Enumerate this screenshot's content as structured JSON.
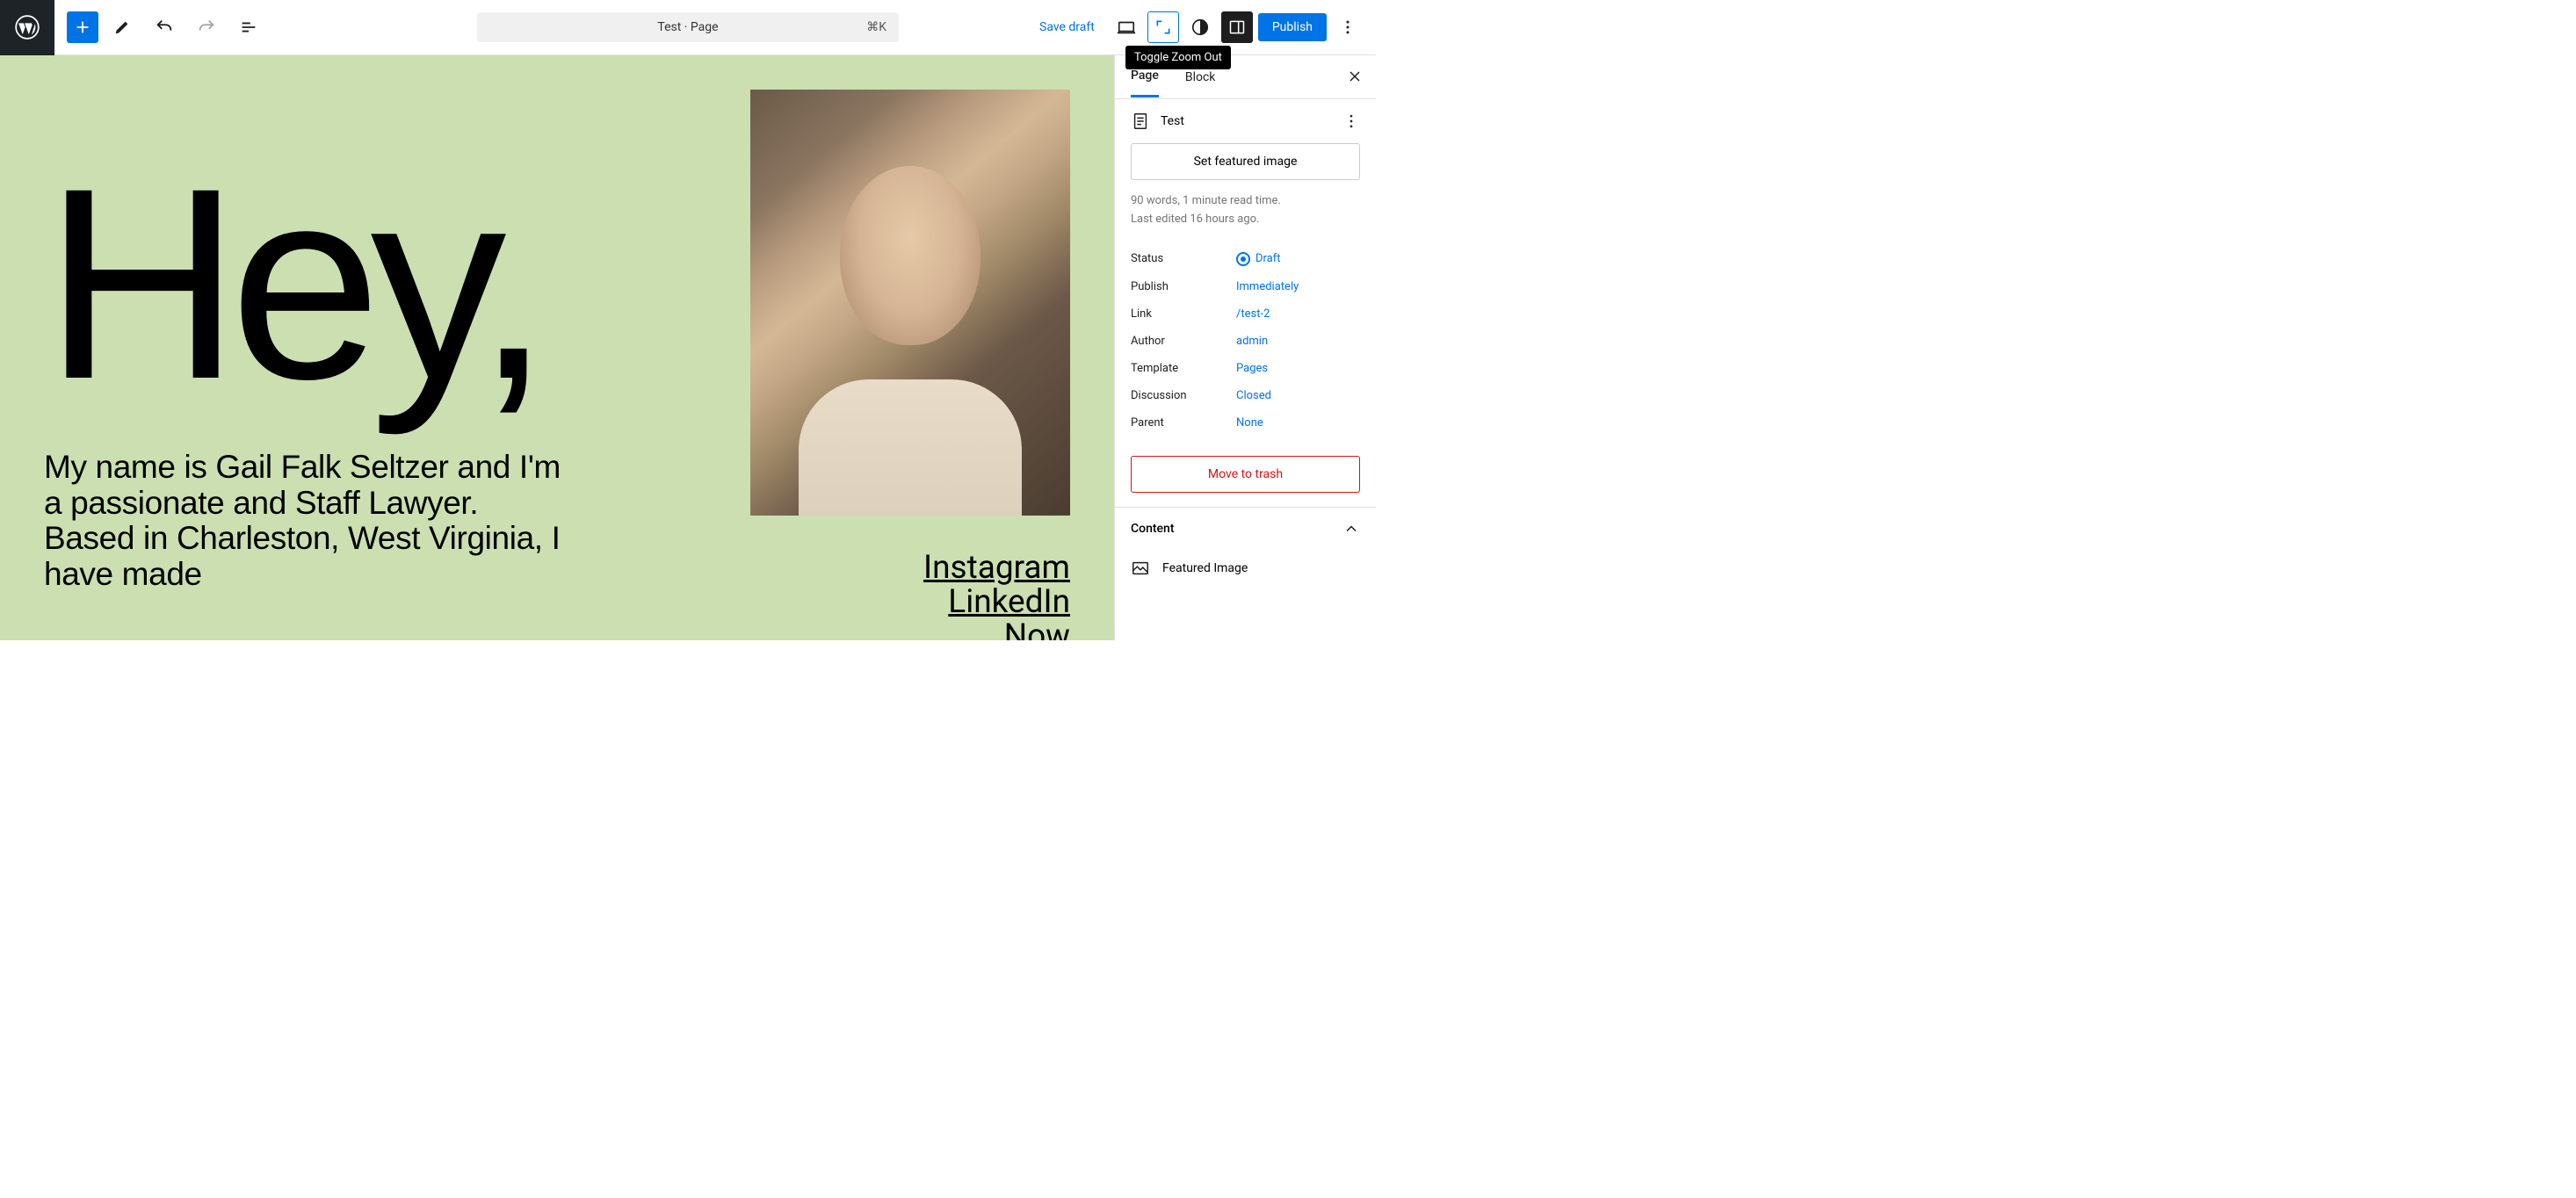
{
  "topbar": {
    "doc_title": "Test · Page",
    "kbd": "⌘K",
    "save_draft": "Save draft",
    "publish": "Publish",
    "tooltip": "Toggle Zoom Out"
  },
  "canvas": {
    "heading": "Hey,",
    "intro": "My name is Gail Falk Seltzer and I'm a passionate and Staff Lawyer. Based in Charleston, West Virginia, I have made",
    "links": [
      "Instagram",
      "LinkedIn",
      "Now"
    ]
  },
  "sidebar": {
    "tabs": {
      "page": "Page",
      "block": "Block"
    },
    "page_title": "Test",
    "featured_btn": "Set featured image",
    "meta1": "90 words, 1 minute read time.",
    "meta2": "Last edited 16 hours ago.",
    "props": {
      "status_label": "Status",
      "status_val": "Draft",
      "publish_label": "Publish",
      "publish_val": "Immediately",
      "link_label": "Link",
      "link_val": "/test-2",
      "author_label": "Author",
      "author_val": "admin",
      "template_label": "Template",
      "template_val": "Pages",
      "discussion_label": "Discussion",
      "discussion_val": "Closed",
      "parent_label": "Parent",
      "parent_val": "None"
    },
    "trash": "Move to trash",
    "content_panel": "Content",
    "featured_item": "Featured Image"
  }
}
